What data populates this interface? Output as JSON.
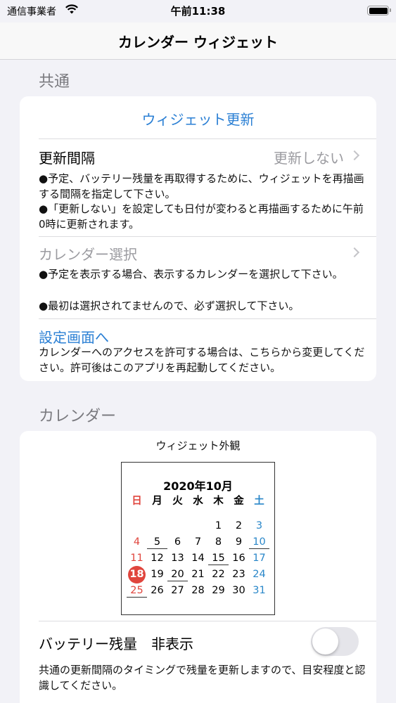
{
  "status": {
    "carrier": "通信事業者",
    "time": "午前11:38"
  },
  "nav": {
    "title": "カレンダー ウィジェット"
  },
  "common": {
    "header": "共通",
    "update_widget": "ウィジェット更新",
    "interval": {
      "label": "更新間隔",
      "value": "更新しない"
    },
    "interval_note_1": "●予定、バッテリー残量を再取得するために、ウィジェットを再描画する間隔を指定して下さい。",
    "interval_note_2": "●「更新しない」を設定しても日付が変わると再描画するために午前0時に更新されます。",
    "calendar_select": {
      "label": "カレンダー選択"
    },
    "select_note_1": "●予定を表示する場合、表示するカレンダーを選択して下さい。",
    "select_note_2": "●最初は選択されてませんので、必ず選択して下さい。",
    "settings_link": "設定画面へ",
    "settings_note": "カレンダーへのアクセスを許可する場合は、こちらから変更してください。許可後はこのアプリを再起動してください。"
  },
  "calendar_section": {
    "header": "カレンダー",
    "preview_title": "ウィジェット外観",
    "month_title": "2020年10月",
    "weekdays": [
      "日",
      "月",
      "火",
      "水",
      "木",
      "金",
      "土"
    ],
    "days": [
      [
        "",
        "",
        "",
        "",
        "1",
        "2",
        "3"
      ],
      [
        "4",
        "5",
        "6",
        "7",
        "8",
        "9",
        "10"
      ],
      [
        "11",
        "12",
        "13",
        "14",
        "15",
        "16",
        "17"
      ],
      [
        "18",
        "19",
        "20",
        "21",
        "22",
        "23",
        "24"
      ],
      [
        "25",
        "26",
        "27",
        "28",
        "29",
        "30",
        "31"
      ]
    ],
    "today": "18",
    "underlined_days": [
      "5",
      "10",
      "15",
      "20",
      "25"
    ],
    "colors": {
      "sunday": "#e0453d",
      "saturday": "#2a87c9",
      "today_bg": "#e0453d"
    },
    "battery": {
      "label": "バッテリー残量　非表示",
      "toggle_on": false
    },
    "battery_note": "共通の更新間隔のタイミングで残量を更新しますので、目安程度と認識してください。"
  },
  "colors": {
    "link": "#2a7fd4",
    "background": "#f2f2f7"
  }
}
